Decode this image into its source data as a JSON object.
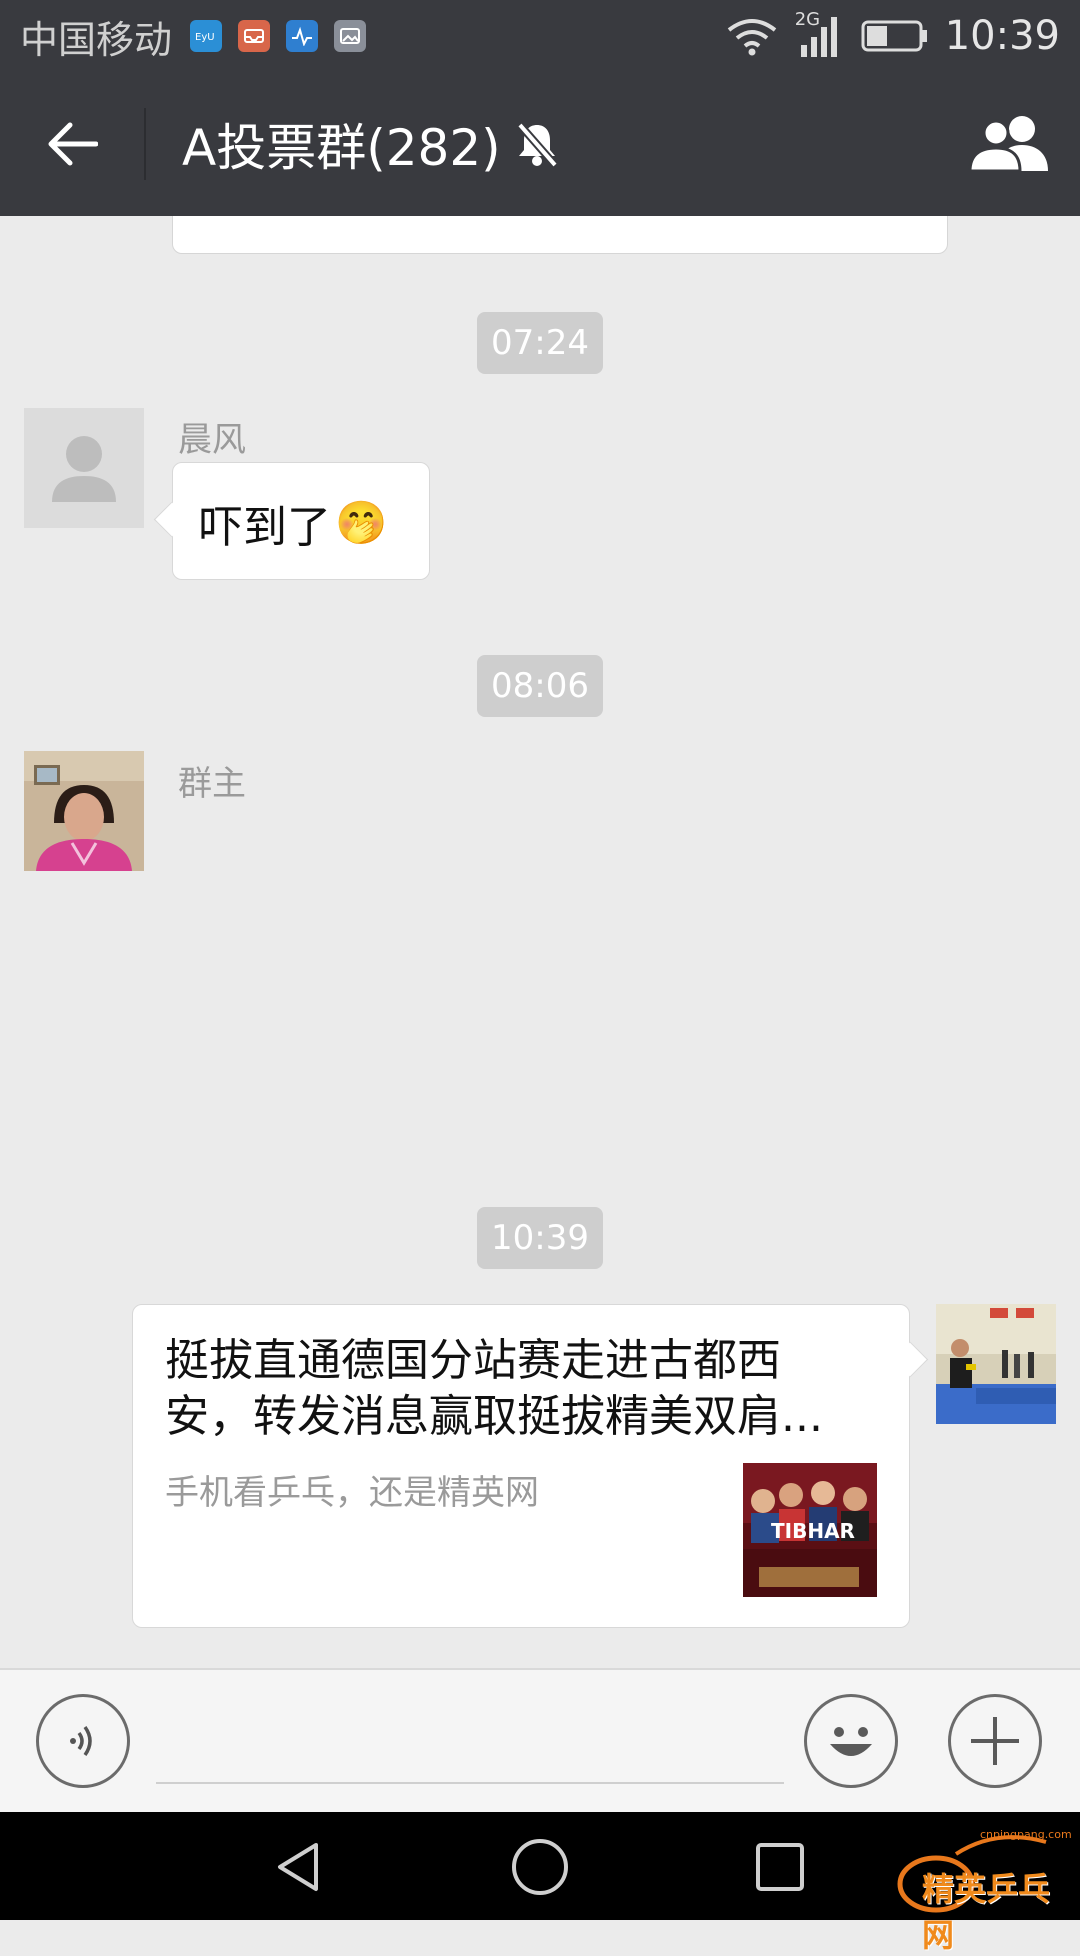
{
  "status_bar": {
    "carrier": "中国移动",
    "network": "2G",
    "time": "10:39",
    "battery_level": 0.4
  },
  "header": {
    "title": "A投票群(282)",
    "back_icon": "arrow-left-icon",
    "muted_icon": "bell-off-icon",
    "members_icon": "group-members-icon"
  },
  "messages": {
    "time1": "07:24",
    "msg1_sender": "晨风",
    "msg1_text": "吓到了",
    "msg1_emoji": "🤭",
    "time2": "08:06",
    "msg2_sender": "群主",
    "time3": "10:39",
    "card_title": "挺拔直通德国分站赛走进古都西安，转发消息赢取挺拔精美双肩...",
    "card_desc": "手机看乒乓，还是精英网",
    "card_thumb_text": "TIBHAR"
  },
  "input_bar": {
    "voice_icon": "voice-icon",
    "emoji_icon": "emoji-icon",
    "plus_icon": "plus-icon",
    "text_value": ""
  },
  "watermark": {
    "text": "精英乒乓网",
    "url": "cnpingpang.com"
  },
  "colors": {
    "header_bg": "#393a3f",
    "chat_bg": "#ebebeb",
    "time_chip": "#cecece"
  }
}
